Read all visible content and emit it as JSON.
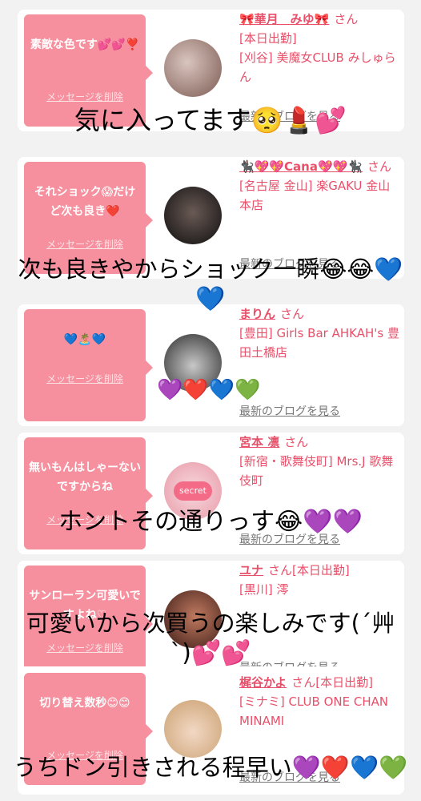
{
  "delete_label": "メッセージを削除",
  "blog_label": "最新のブログを見る",
  "san_label": "さん",
  "cards": [
    {
      "message": "素敵な色です💕💕❣️",
      "name": "🎀華月　みゆ🎀",
      "status": "[本日出勤]",
      "shop": "[刈谷] 美魔女CLUB みしゅらん",
      "avatar_colors": [
        "#c9b3ad",
        "#7b5a52"
      ]
    },
    {
      "message": "それショック😱だけど次も良き❤️",
      "name": "🐈‍⬛💖💖Cana💖💖🐈‍⬛",
      "status": "",
      "shop": "[名古屋 金山] 楽GAKU 金山本店",
      "avatar_colors": [
        "#2a2a2a",
        "#101010"
      ]
    },
    {
      "message": "💙🏝️💙",
      "name": "まりん",
      "status": "",
      "shop": "[豊田] Girls Bar AHKAH's 豊田土橋店",
      "avatar_colors": [
        "#3a3a3a",
        "#bfbfbf"
      ]
    },
    {
      "message": "無いもんはしゃーないですからね",
      "name": "宮本 凛",
      "status": "",
      "shop": "[新宿・歌舞伎町] Mrs.J 歌舞伎町",
      "avatar_colors": [
        "#f2c8cf",
        "#e89aa8"
      ],
      "avatar_badge": "secret"
    },
    {
      "message": "サンローラン可愛いですよね♡",
      "name": "ユナ",
      "status": "[本日出勤]",
      "shop": "[黒川] 澪",
      "avatar_colors": [
        "#5a2a22",
        "#c07a60"
      ]
    },
    {
      "message": "切り替え数秒😊😊",
      "name": "梶谷かよ",
      "status": "[本日出勤]",
      "shop": "[ミナミ] CLUB ONE CHAN MINAMI",
      "avatar_colors": [
        "#e8d2bf",
        "#f5ddb0"
      ]
    }
  ],
  "captions": [
    "気に入ってます🥺💄💕",
    "次も良きやからショック一瞬😂😂💙",
    "💙",
    "💜❤️💙💚",
    "ホントその通りっす😂💜💜",
    "可愛いから次買うの楽しみです(´艸",
    "`)💕💕",
    "うちドン引きされる程早い💜❤️💙💚"
  ],
  "colors": {
    "accent": "#f6909e",
    "name_pink": "#e8506a",
    "background": "#f2f2f2"
  }
}
